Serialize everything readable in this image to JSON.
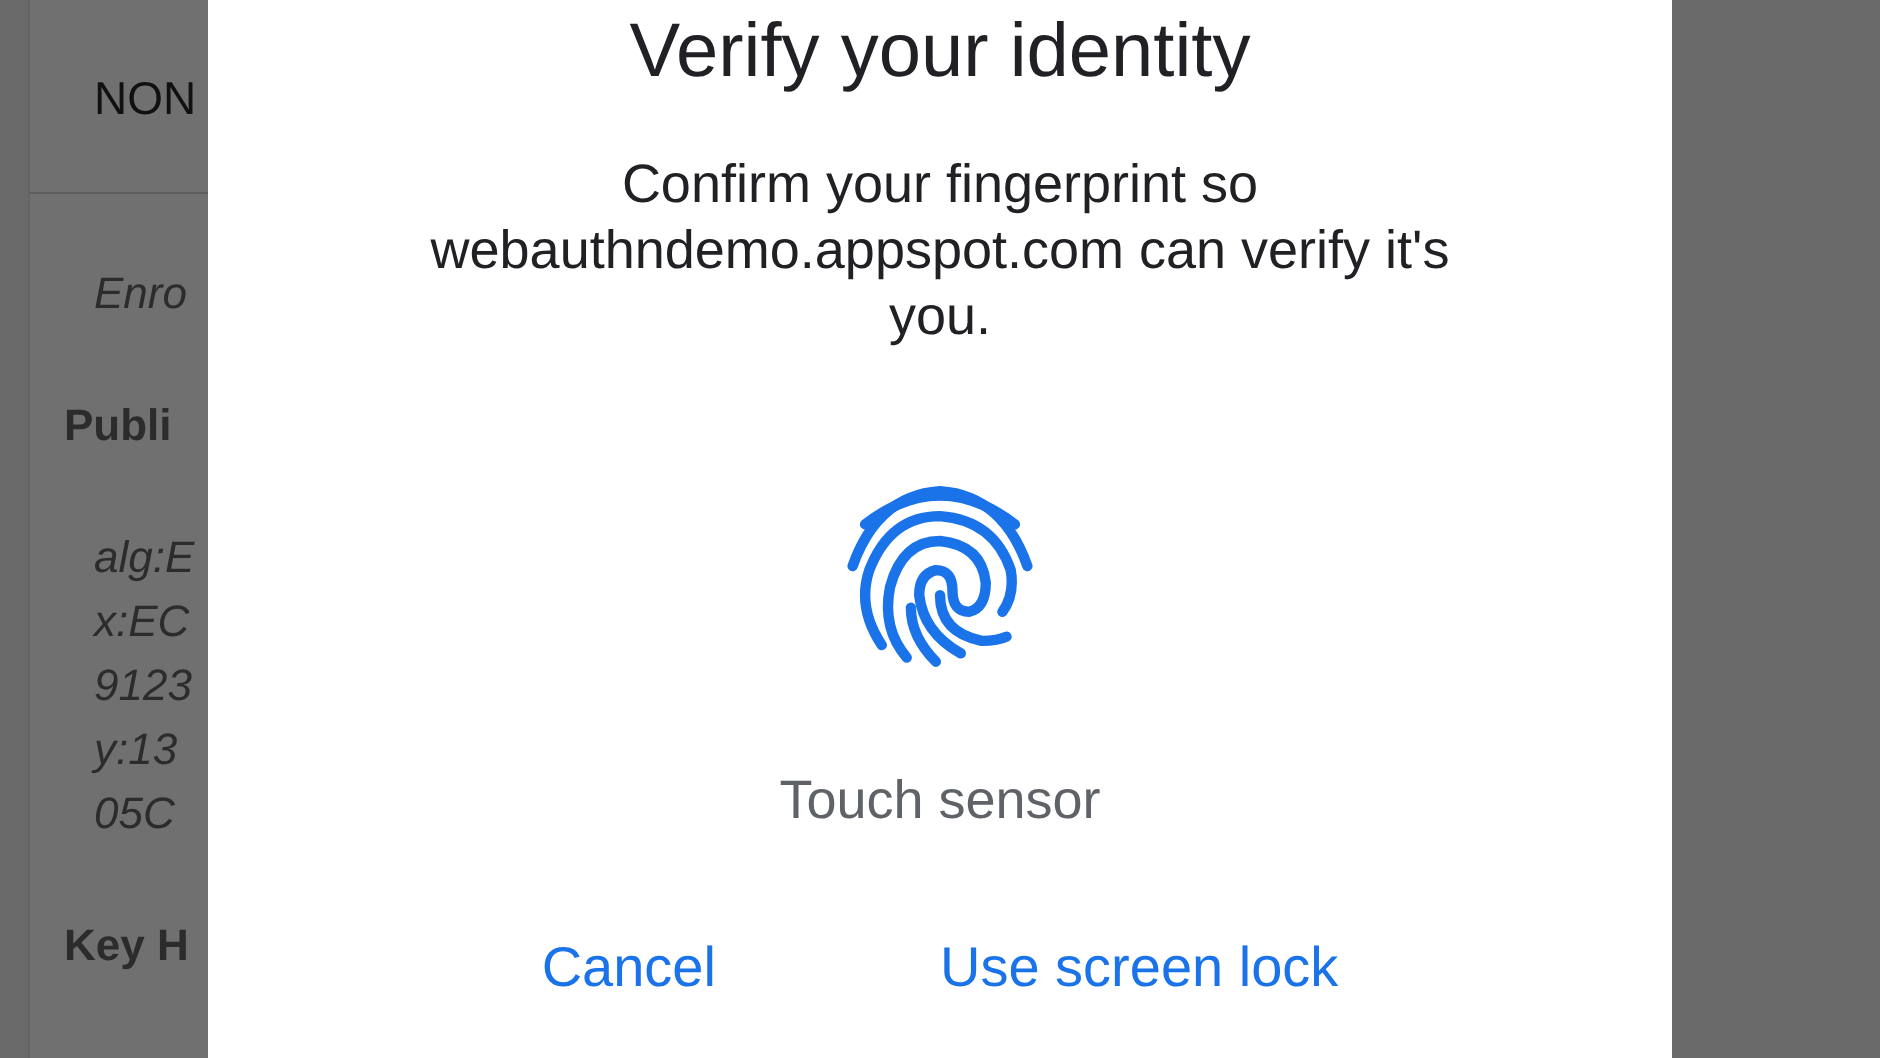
{
  "background_page": {
    "header": "NON",
    "lines": [
      {
        "kind": "italic",
        "text": "Enro"
      },
      {
        "kind": "bold",
        "text": "Publi"
      },
      {
        "kind": "italic",
        "text": "alg:E"
      },
      {
        "kind": "italic",
        "text": "x:EC"
      },
      {
        "kind": "italic",
        "text": "9123"
      },
      {
        "kind": "italic",
        "text": "y:13"
      },
      {
        "kind": "italic",
        "text": "05C"
      },
      {
        "kind": "bold",
        "text": "Key H"
      }
    ]
  },
  "dialog": {
    "title": "Verify your identity",
    "message": "Confirm your fingerprint so webauthndemo.appspot.com can verify it's you.",
    "sensor_label": "Touch sensor",
    "buttons": [
      "Cancel",
      "Use screen lock"
    ]
  }
}
